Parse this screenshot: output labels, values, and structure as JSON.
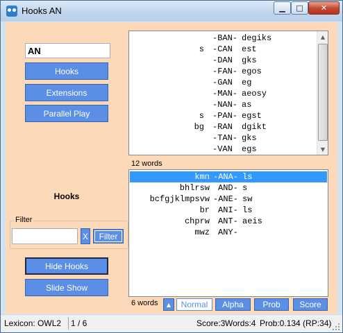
{
  "window": {
    "title": "Hooks AN"
  },
  "word_input": {
    "value": "AN"
  },
  "buttons": {
    "hooks": "Hooks",
    "extensions": "Extensions",
    "parallel_play": "Parallel Play",
    "hide_hooks": "Hide Hooks",
    "slide_show": "Slide Show"
  },
  "hooks_label": "Hooks",
  "filter": {
    "legend": "Filter",
    "value": "",
    "clear_label": "X",
    "button_label": "Filter"
  },
  "top_list": {
    "rows": [
      {
        "front": "",
        "word": "-BAN-",
        "back": "degiks"
      },
      {
        "front": "s",
        "word": "-CAN",
        "back": "est"
      },
      {
        "front": "",
        "word": "-DAN",
        "back": "gks"
      },
      {
        "front": "",
        "word": "-FAN-",
        "back": "egos"
      },
      {
        "front": "",
        "word": "-GAN",
        "back": "eg"
      },
      {
        "front": "",
        "word": "-MAN-",
        "back": "aeosy"
      },
      {
        "front": "",
        "word": "-NAN-",
        "back": "as"
      },
      {
        "front": "s",
        "word": "-PAN-",
        "back": "egst"
      },
      {
        "front": "bg",
        "word": "-RAN",
        "back": "dgikt"
      },
      {
        "front": "",
        "word": "-TAN-",
        "back": "gks"
      },
      {
        "front": "",
        "word": "-VAN",
        "back": "egs"
      }
    ],
    "count_label": "12 words"
  },
  "bottom_list": {
    "rows": [
      {
        "front": "kmn",
        "word": "-ANA-",
        "back": "ls",
        "selected": true
      },
      {
        "front": "bhlrsw",
        "word": "AND-",
        "back": "s",
        "selected": false
      },
      {
        "front": "bcfgjklmpsvw",
        "word": "-ANE-",
        "back": "sw",
        "selected": false
      },
      {
        "front": "br",
        "word": "ANI-",
        "back": "ls",
        "selected": false
      },
      {
        "front": "chprw",
        "word": "ANT-",
        "back": "aeis",
        "selected": false
      },
      {
        "front": "mwz",
        "word": "ANY-",
        "back": "",
        "selected": false
      }
    ],
    "count_label": "6 words"
  },
  "sort": {
    "up_icon": "triangle-up-icon",
    "options": [
      "Normal",
      "Alpha",
      "Prob",
      "Score"
    ],
    "active": "Normal"
  },
  "status": {
    "lexicon": "Lexicon: OWL2",
    "page": "1 / 6",
    "score": "Score:3",
    "words": "Words:4",
    "prob": "Prob:0.134 (RP:34)"
  },
  "colors": {
    "panel_bg": "#fcd9b9",
    "button_blue": "#5b8fe6",
    "selection": "#3399ff"
  }
}
